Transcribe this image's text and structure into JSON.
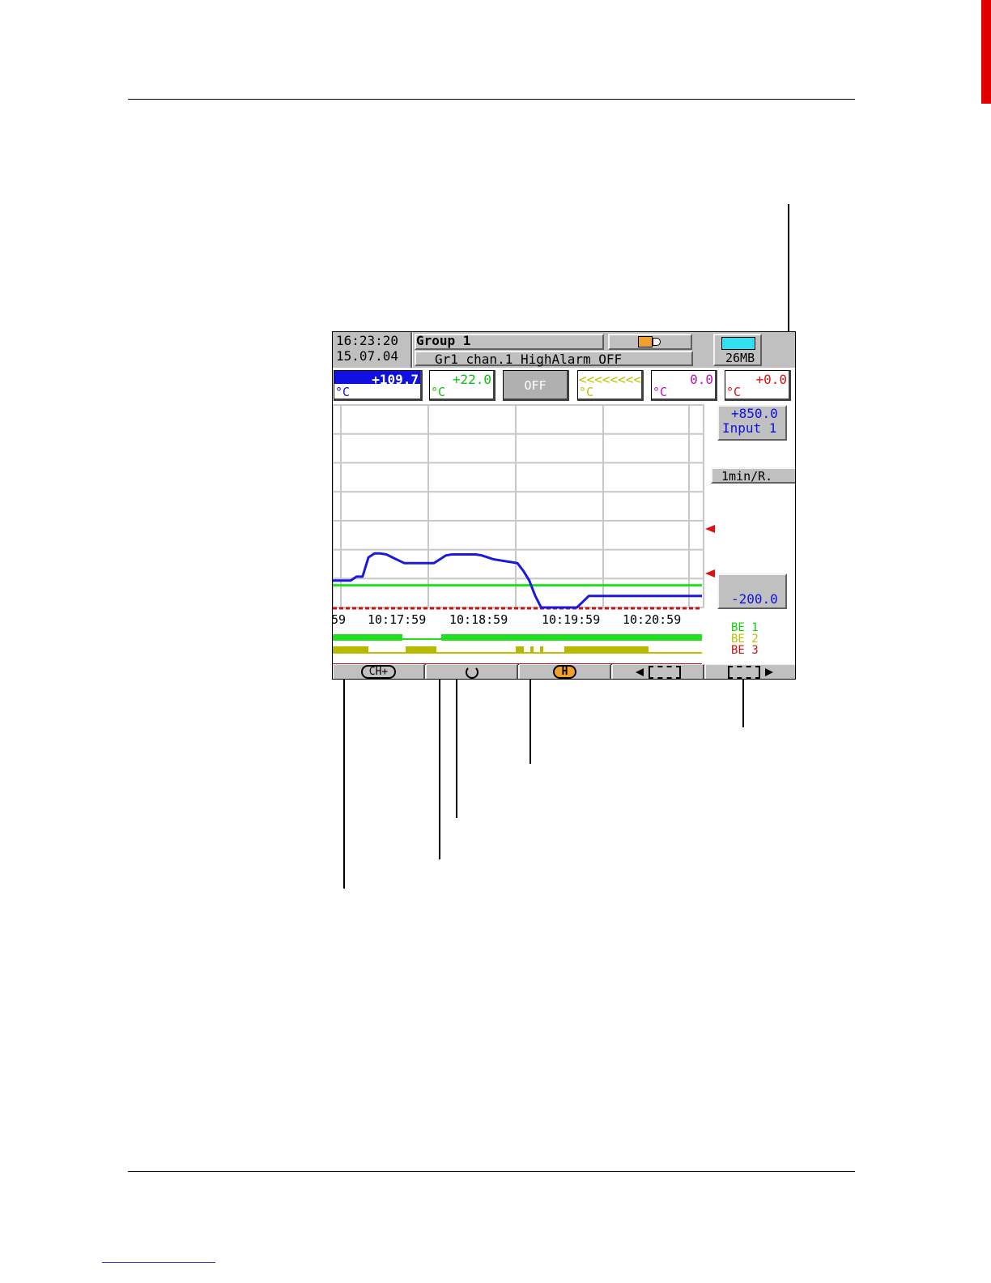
{
  "header": {
    "time": "16:23:20",
    "date": "15.07.04",
    "group_title": "Group 1",
    "status_message": "Gr1 chan.1 HighAlarm OFF",
    "memory": "26MB"
  },
  "channels": [
    {
      "value": "+109.7",
      "unit": "°C",
      "color": "#1010e0",
      "highlighted": true
    },
    {
      "value": "+22.0",
      "unit": "°C",
      "color": "#10c010"
    },
    {
      "value": "OFF",
      "unit": "",
      "color": "#ffffff",
      "off": true
    },
    {
      "value": "<<<<<<<<",
      "unit": "°C",
      "color": "#c0c000"
    },
    {
      "value": "0.0",
      "unit": "°C",
      "color": "#c010c0"
    },
    {
      "value": "+0.0",
      "unit": "°C",
      "color": "#e01010"
    }
  ],
  "scale": {
    "max_value": "+850.0",
    "max_label": "Input 1",
    "speed": "1min/R.",
    "min_value": "-200.0"
  },
  "time_axis": [
    "59",
    "10:17:59",
    "10:18:59",
    "10:19:59",
    "10:20:59"
  ],
  "binary_inputs": [
    {
      "label": "BE 1",
      "color": "#10d010"
    },
    {
      "label": "BE 2",
      "color": "#c0c000"
    },
    {
      "label": "BE 3",
      "color": "#d01010"
    }
  ],
  "softkeys": {
    "ch_plus": "CH+",
    "history": "H"
  },
  "colors": {
    "trace": "#1a1ad8",
    "limit_line": "#20e020",
    "baseline": "#d01010",
    "grid": "#c8c8c8",
    "screen_gray": "#c0c0c0"
  },
  "chart_data": {
    "type": "line",
    "ylim": [
      -200,
      850
    ],
    "xlabels": [
      "59",
      "10:17:59",
      "10:18:59",
      "10:19:59",
      "10:20:59"
    ],
    "series": [
      {
        "values": [
          -60,
          -60,
          -60,
          -60,
          -40,
          -40,
          60,
          80,
          80,
          75,
          60,
          45,
          30,
          30,
          30,
          30,
          30,
          30,
          50,
          70,
          75,
          75,
          75,
          75,
          75,
          70,
          60,
          50,
          45,
          40,
          35,
          30,
          -10,
          -60,
          -140,
          -200,
          -200,
          -200,
          -200,
          -200,
          -200,
          -200,
          -170,
          -140,
          -140,
          -140,
          -140,
          -140,
          -140,
          -140,
          -140,
          -140,
          -140,
          -140,
          -140,
          -140,
          -140,
          -140,
          -140,
          -140,
          -140,
          -140,
          -140
        ]
      }
    ],
    "limit_value": -85
  }
}
